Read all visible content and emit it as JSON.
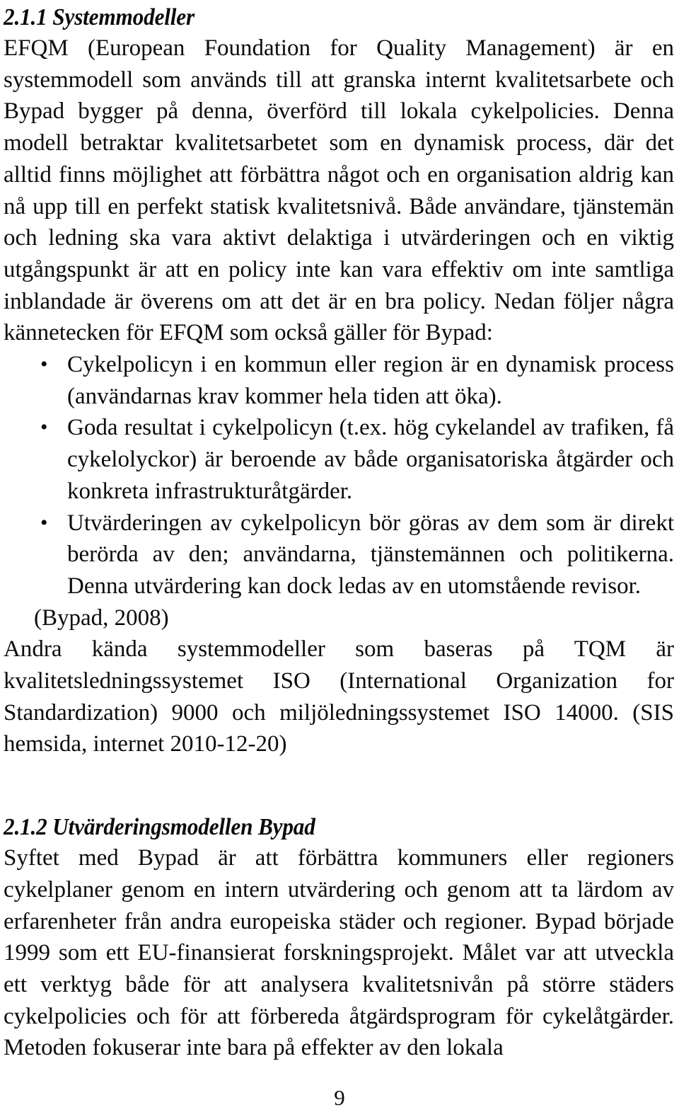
{
  "document": {
    "language": "sv",
    "page_number": "9"
  },
  "sections": [
    {
      "heading": "2.1.1 Systemmodeller",
      "paragraphs": [
        "EFQM (European Foundation for Quality Management) är en systemmodell som används till att granska internt kvalitetsarbete och Bypad bygger på denna, överförd till lokala cykelpolicies. Denna modell betraktar kvalitetsarbetet som en dynamisk process, där det alltid finns möjlighet att förbättra något och en organisation aldrig kan nå upp till en perfekt statisk kvalitetsnivå. Både användare, tjänstemän och ledning ska vara aktivt delaktiga i utvärderingen och en viktig utgångspunkt är att en policy inte kan vara effektiv om inte samtliga inblandade är överens om att det är en bra policy. Nedan följer några kännetecken för EFQM som också gäller för Bypad:"
      ],
      "bullets": [
        "Cykelpolicyn i en kommun eller region är en dynamisk process (användarnas krav kommer hela tiden att öka).",
        "Goda resultat i cykelpolicyn (t.ex. hög cykelandel av trafiken, få cykelolyckor) är beroende av både organisatoriska åtgärder och konkreta infrastrukturåtgärder.",
        "Utvärderingen av cykelpolicyn bör göras av dem som är direkt berörda av den; användarna, tjänstemännen och politikerna. Denna utvärdering kan dock ledas av en utomstående revisor."
      ],
      "citation": "(Bypad, 2008)",
      "paragraphs_after_citation": [
        "Andra kända systemmodeller som baseras på TQM är kvalitetsledningssystemet ISO (International Organization for Standardization) 9000 och miljöledningssystemet ISO 14000. (SIS hemsida, internet 2010-12-20)"
      ]
    },
    {
      "heading": "2.1.2 Utvärderingsmodellen Bypad",
      "paragraphs": [
        "Syftet med Bypad är att förbättra kommuners eller regioners cykelplaner genom en intern utvärdering och genom att ta lärdom av erfarenheter från andra europeiska städer och regioner. Bypad började 1999 som ett EU-finansierat forskningsprojekt. Målet var att utveckla ett verktyg både för att analysera kvalitetsnivån på större städers cykelpolicies och för att förbereda åtgärdsprogram för cykelåtgärder. Metoden fokuserar inte bara på effekter av den lokala"
      ],
      "bullets": [],
      "citation": "",
      "paragraphs_after_citation": []
    }
  ],
  "glyphs": {
    "bullet": "•"
  }
}
